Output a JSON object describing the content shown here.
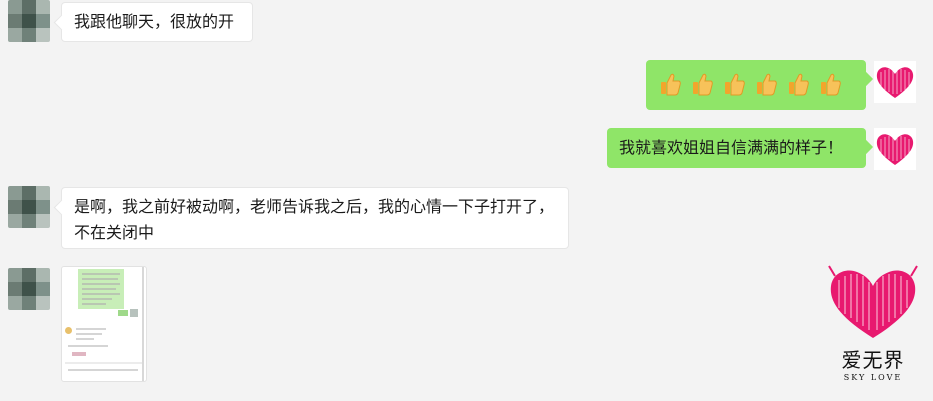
{
  "messages": [
    {
      "side": "left",
      "text": "我跟他聊天，很放的开"
    },
    {
      "side": "right",
      "text": "👍👍👍👍👍👍"
    },
    {
      "side": "right",
      "text": "我就喜欢姐姐自信满满的样子！"
    },
    {
      "side": "left",
      "text": "是啊，我之前好被动啊，老师告诉我之后，我的心情一下子打开了，不在关闭中"
    },
    {
      "side": "left",
      "type": "image",
      "text": ""
    }
  ],
  "thumbs_count": 6,
  "watermark": {
    "cn": "爱无界",
    "en": "SKY LOVE"
  },
  "colors": {
    "background": "#f3f3f3",
    "sent_bubble": "#8fe568",
    "received_bubble": "#ffffff",
    "heart": "#e8196f"
  }
}
